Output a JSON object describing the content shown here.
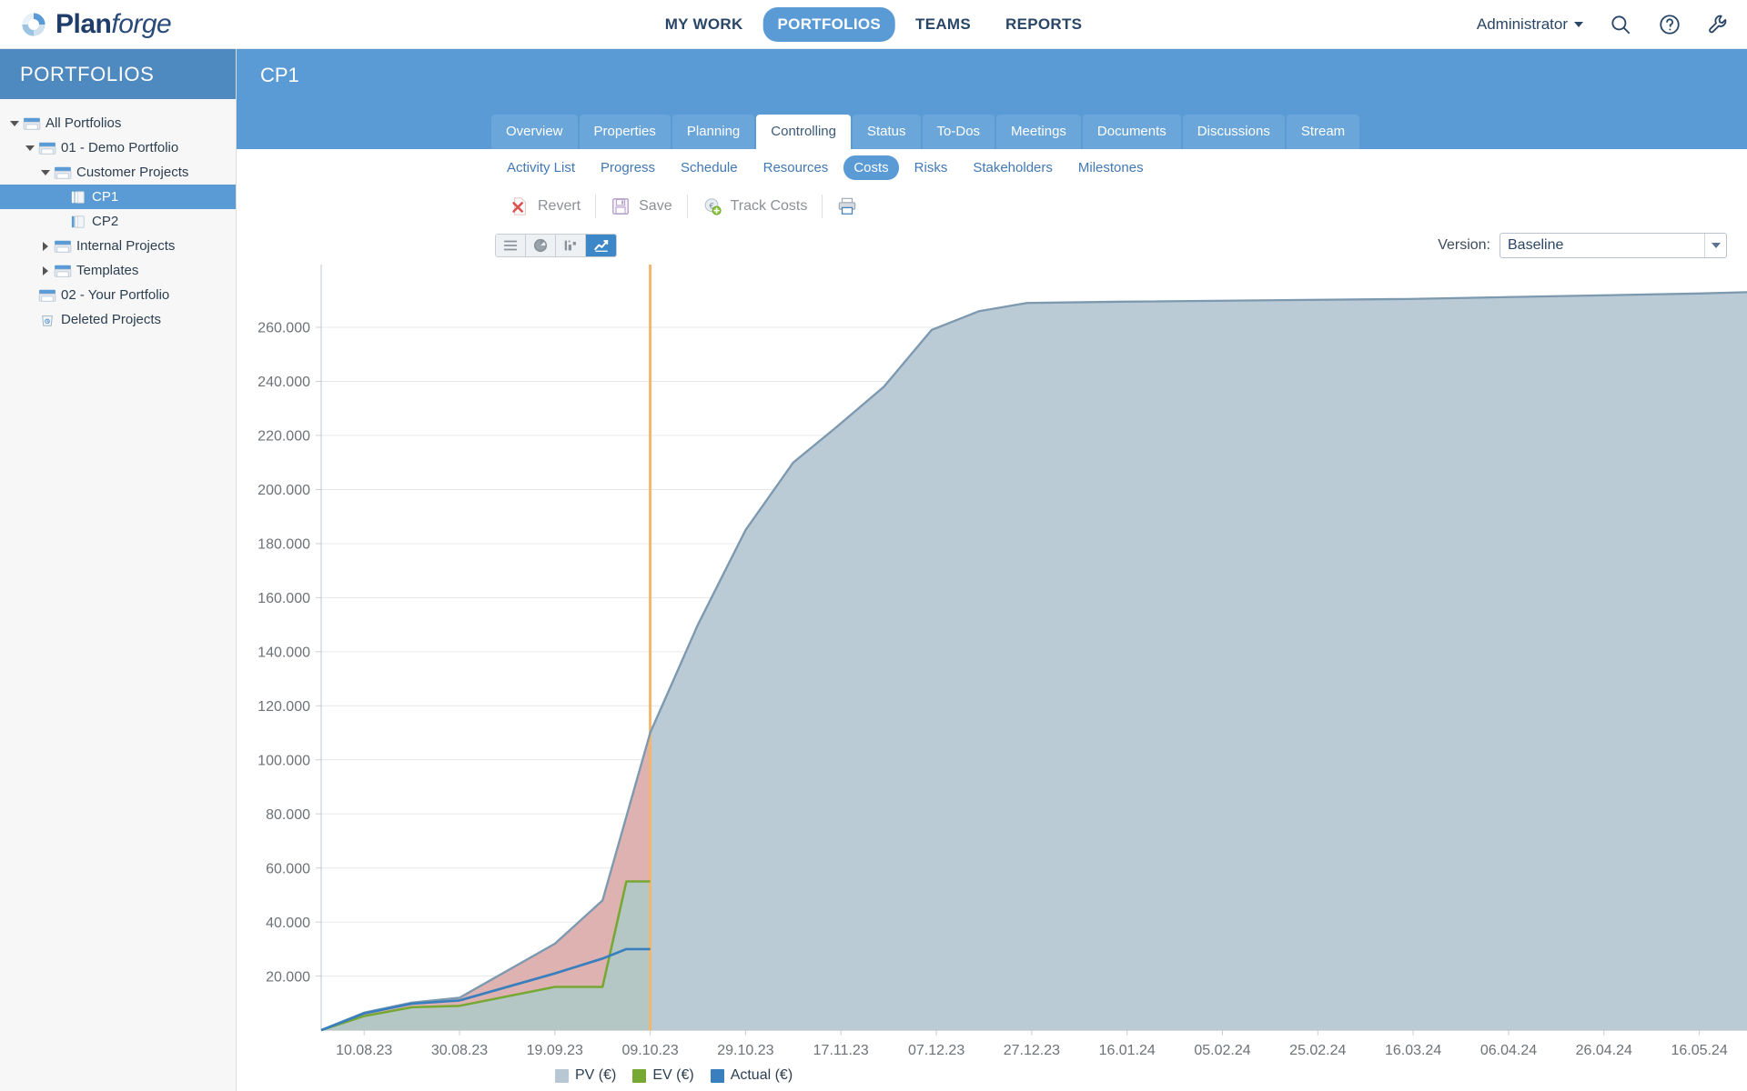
{
  "brand": {
    "name_bold": "Plan",
    "name_light": "forge"
  },
  "topnav": {
    "items": [
      {
        "label": "MY WORK",
        "active": false
      },
      {
        "label": "PORTFOLIOS",
        "active": true
      },
      {
        "label": "TEAMS",
        "active": false
      },
      {
        "label": "REPORTS",
        "active": false
      }
    ],
    "user": "Administrator",
    "icons": [
      "search-icon",
      "help-icon",
      "tools-icon"
    ]
  },
  "sidebar": {
    "title": "PORTFOLIOS",
    "items": [
      {
        "label": "All Portfolios",
        "indent": 0,
        "twist": "open",
        "icon": "portfolio-icon",
        "selected": false
      },
      {
        "label": "01 - Demo Portfolio",
        "indent": 1,
        "twist": "open",
        "icon": "portfolio-icon",
        "selected": false
      },
      {
        "label": "Customer Projects",
        "indent": 2,
        "twist": "open",
        "icon": "portfolio-icon",
        "selected": false
      },
      {
        "label": "CP1",
        "indent": 3,
        "twist": "none",
        "icon": "project-icon",
        "selected": true
      },
      {
        "label": "CP2",
        "indent": 3,
        "twist": "none",
        "icon": "project-icon",
        "selected": false
      },
      {
        "label": "Internal Projects",
        "indent": 2,
        "twist": "closed",
        "icon": "portfolio-icon",
        "selected": false
      },
      {
        "label": "Templates",
        "indent": 2,
        "twist": "closed",
        "icon": "portfolio-icon",
        "selected": false
      },
      {
        "label": "02 - Your Portfolio",
        "indent": 1,
        "twist": "none",
        "icon": "portfolio-icon",
        "selected": false
      },
      {
        "label": "Deleted Projects",
        "indent": 1,
        "twist": "none",
        "icon": "trash-icon",
        "selected": false
      }
    ]
  },
  "project": {
    "title": "CP1",
    "tabs": [
      {
        "label": "Overview",
        "active": false
      },
      {
        "label": "Properties",
        "active": false
      },
      {
        "label": "Planning",
        "active": false
      },
      {
        "label": "Controlling",
        "active": true
      },
      {
        "label": "Status",
        "active": false
      },
      {
        "label": "To-Dos",
        "active": false
      },
      {
        "label": "Meetings",
        "active": false
      },
      {
        "label": "Documents",
        "active": false
      },
      {
        "label": "Discussions",
        "active": false
      },
      {
        "label": "Stream",
        "active": false
      }
    ],
    "subtabs": [
      {
        "label": "Activity List",
        "active": false
      },
      {
        "label": "Progress",
        "active": false
      },
      {
        "label": "Schedule",
        "active": false
      },
      {
        "label": "Resources",
        "active": false
      },
      {
        "label": "Costs",
        "active": true
      },
      {
        "label": "Risks",
        "active": false
      },
      {
        "label": "Stakeholders",
        "active": false
      },
      {
        "label": "Milestones",
        "active": false
      }
    ]
  },
  "toolbar": {
    "revert_label": "Revert",
    "save_label": "Save",
    "track_costs_label": "Track Costs",
    "print_icon": "printer-icon"
  },
  "viewbar": {
    "buttons": [
      {
        "icon": "list-view-icon",
        "active": false
      },
      {
        "icon": "pie-chart-icon",
        "active": false
      },
      {
        "icon": "bar-chart-icon",
        "active": false
      },
      {
        "icon": "line-chart-icon",
        "active": true
      }
    ],
    "version_label": "Version:",
    "version_value": "Baseline"
  },
  "chart_data": {
    "type": "area",
    "title": "",
    "xlabel": "",
    "ylabel": "",
    "ylim": [
      0,
      280000
    ],
    "yticks": [
      20000,
      40000,
      60000,
      80000,
      100000,
      120000,
      140000,
      160000,
      180000,
      200000,
      220000,
      240000,
      260000
    ],
    "ytick_labels": [
      "20.000",
      "40.000",
      "60.000",
      "80.000",
      "100.000",
      "120.000",
      "140.000",
      "160.000",
      "180.000",
      "200.000",
      "220.000",
      "240.000",
      "260.000"
    ],
    "xtick_labels": [
      "10.08.23",
      "30.08.23",
      "19.09.23",
      "09.10.23",
      "29.10.23",
      "17.11.23",
      "07.12.23",
      "27.12.23",
      "16.01.24",
      "05.02.24",
      "25.02.24",
      "16.03.24",
      "06.04.24",
      "26.04.24",
      "16.05.24"
    ],
    "grid": true,
    "legend_position": "bottom-left",
    "colors": {
      "pv": "#b7c8d4",
      "pv_line": "#7d99b0",
      "ev": "#76a833",
      "actual": "#3a7fbd",
      "today_line": "#f2b66d",
      "variance_fill": "#e8a9a4"
    },
    "today_marker": "09.10.23",
    "series": [
      {
        "name": "PV (€)",
        "key": "pv",
        "color": "#b7c8d4",
        "points": [
          {
            "x": "01.08.23",
            "y": 0
          },
          {
            "x": "10.08.23",
            "y": 6500
          },
          {
            "x": "20.08.23",
            "y": 10200
          },
          {
            "x": "30.08.23",
            "y": 12000
          },
          {
            "x": "19.09.23",
            "y": 32000
          },
          {
            "x": "29.09.23",
            "y": 48000
          },
          {
            "x": "09.10.23",
            "y": 110000
          },
          {
            "x": "19.10.23",
            "y": 150000
          },
          {
            "x": "29.10.23",
            "y": 185000
          },
          {
            "x": "08.11.23",
            "y": 210000
          },
          {
            "x": "17.11.23",
            "y": 223000
          },
          {
            "x": "27.11.23",
            "y": 238000
          },
          {
            "x": "07.12.23",
            "y": 259000
          },
          {
            "x": "17.12.23",
            "y": 266000
          },
          {
            "x": "27.12.23",
            "y": 269000
          },
          {
            "x": "16.01.24",
            "y": 269500
          },
          {
            "x": "16.03.24",
            "y": 270500
          },
          {
            "x": "16.05.24",
            "y": 272500
          },
          {
            "x": "26.05.24",
            "y": 273000
          }
        ]
      },
      {
        "name": "EV (€)",
        "key": "ev",
        "color": "#76a833",
        "points": [
          {
            "x": "01.08.23",
            "y": 0
          },
          {
            "x": "10.08.23",
            "y": 5200
          },
          {
            "x": "20.08.23",
            "y": 8500
          },
          {
            "x": "30.08.23",
            "y": 9000
          },
          {
            "x": "19.09.23",
            "y": 16000
          },
          {
            "x": "29.09.23",
            "y": 16000
          },
          {
            "x": "04.10.23",
            "y": 55000
          },
          {
            "x": "09.10.23",
            "y": 55000
          }
        ]
      },
      {
        "name": "Actual (€)",
        "key": "actual",
        "color": "#3a7fbd",
        "points": [
          {
            "x": "01.08.23",
            "y": 0
          },
          {
            "x": "10.08.23",
            "y": 6200
          },
          {
            "x": "20.08.23",
            "y": 9800
          },
          {
            "x": "30.08.23",
            "y": 11000
          },
          {
            "x": "19.09.23",
            "y": 21000
          },
          {
            "x": "29.09.23",
            "y": 26500
          },
          {
            "x": "04.10.23",
            "y": 30000
          },
          {
            "x": "09.10.23",
            "y": 30000
          }
        ]
      }
    ],
    "legend": [
      {
        "label": "PV (€)",
        "color": "#b7c8d4"
      },
      {
        "label": "EV (€)",
        "color": "#76a833"
      },
      {
        "label": "Actual (€)",
        "color": "#3a7fbd"
      }
    ]
  }
}
